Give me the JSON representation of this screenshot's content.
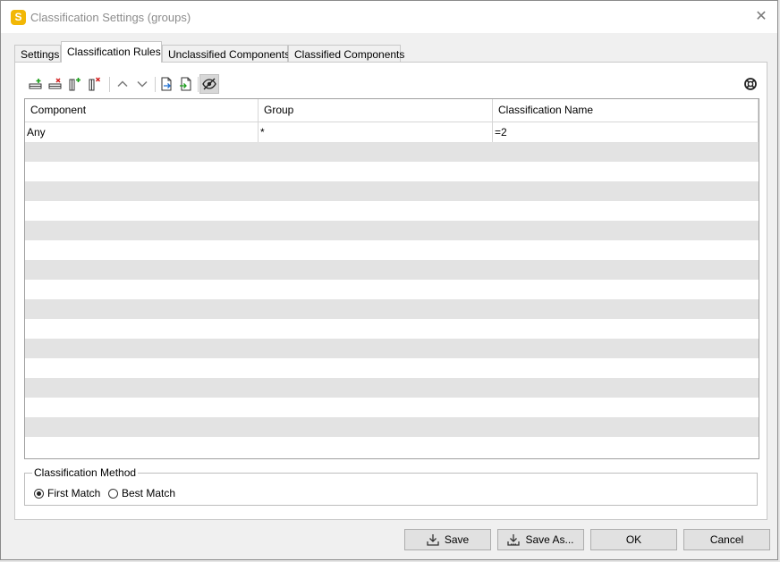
{
  "window": {
    "title": "Classification Settings (groups)",
    "app_icon_letter": "S",
    "close_glyph": "✕"
  },
  "tabs": [
    {
      "label": "Settings",
      "active": false
    },
    {
      "label": "Classification Rules",
      "active": true
    },
    {
      "label": "Unclassified Components",
      "active": false
    },
    {
      "label": "Classified Components",
      "active": false
    }
  ],
  "toolbar": {
    "buttons": [
      "add-row-icon",
      "remove-row-icon",
      "add-column-icon",
      "remove-column-icon",
      "move-up-icon",
      "move-down-icon",
      "export-icon",
      "import-icon",
      "visibility-icon"
    ],
    "help_icon": "help-lifebuoy-icon"
  },
  "grid": {
    "columns": [
      "Component",
      "Group",
      "Classification Name"
    ],
    "rows": [
      [
        "Any",
        "*",
        "=2"
      ]
    ]
  },
  "classification_method": {
    "legend": "Classification Method",
    "options": [
      {
        "label": "First Match",
        "selected": true
      },
      {
        "label": "Best Match",
        "selected": false
      }
    ]
  },
  "buttons": {
    "save": "Save",
    "save_as": "Save As...",
    "ok": "OK",
    "cancel": "Cancel"
  },
  "colors": {
    "app_icon": "#f2b705",
    "alt_row": "#e3e3e3",
    "button_bg": "#e1e1e1"
  }
}
